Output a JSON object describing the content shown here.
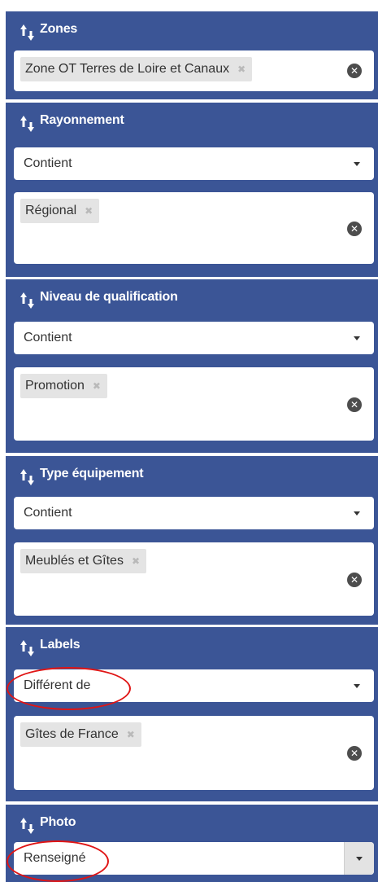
{
  "filters": [
    {
      "id": "zones",
      "title": "Zones",
      "tags": [
        "Zone OT Terres de Loire et Canaux"
      ]
    },
    {
      "id": "rayonnement",
      "title": "Rayonnement",
      "operator": "Contient",
      "tags": [
        "Régional"
      ]
    },
    {
      "id": "niveau",
      "title": "Niveau de qualification",
      "operator": "Contient",
      "tags": [
        "Promotion"
      ]
    },
    {
      "id": "type",
      "title": "Type équipement",
      "operator": "Contient",
      "tags": [
        "Meublés et Gîtes"
      ]
    },
    {
      "id": "labels",
      "title": "Labels",
      "operator": "Différent de",
      "tags": [
        "Gîtes de France"
      ]
    },
    {
      "id": "photo",
      "title": "Photo",
      "operator": "Renseigné"
    }
  ],
  "icons": {
    "sort": "sort-arrows-icon",
    "tag_remove": "✖",
    "clear": "✕",
    "caret": "caret-down-icon"
  },
  "colors": {
    "panel_bg": "#3b5596",
    "highlight": "#e01515",
    "tag_bg": "#e4e4e4"
  }
}
